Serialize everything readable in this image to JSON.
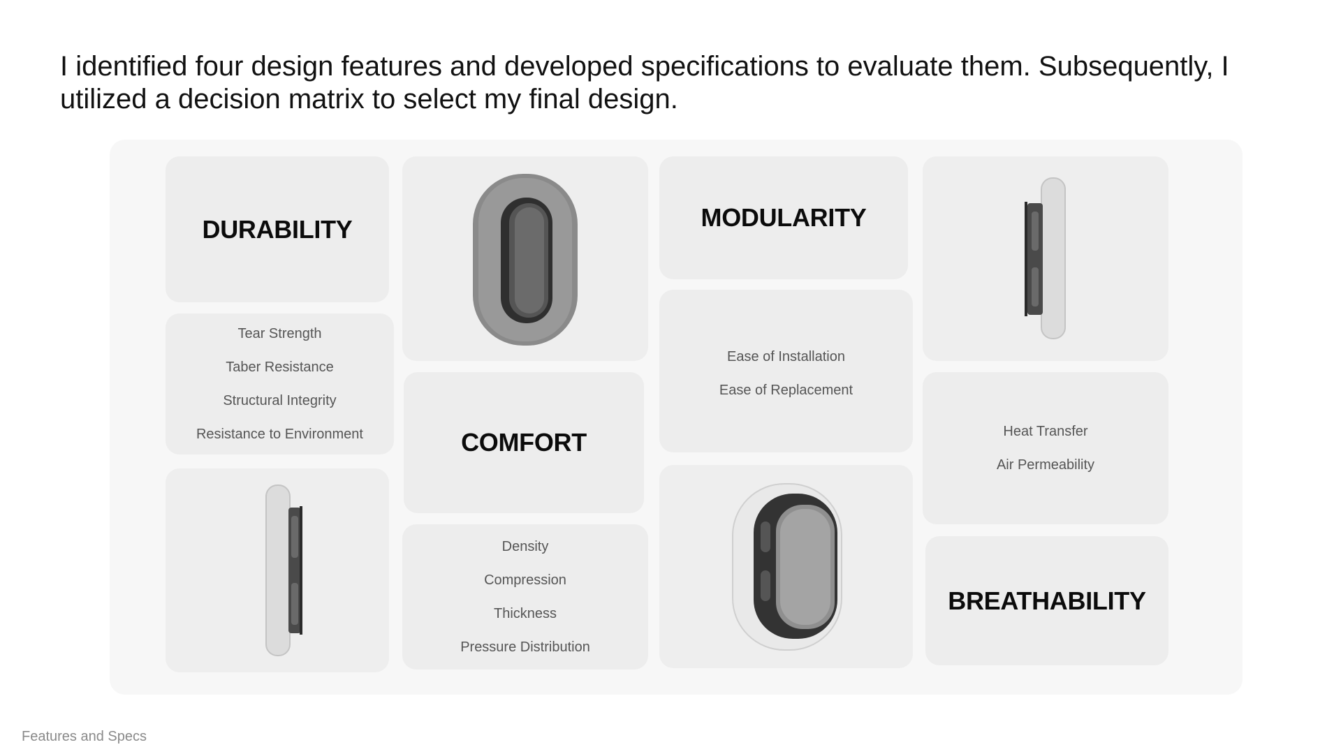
{
  "intro_text": "I identified four design features and developed specifications to evaluate them. Subsequently, I utilized a decision matrix to select my final design.",
  "features": {
    "durability": {
      "title": "DURABILITY",
      "specs": [
        "Tear Strength",
        "Taber Resistance",
        "Structural Integrity",
        "Resistance to Environment"
      ]
    },
    "comfort": {
      "title": "COMFORT",
      "specs": [
        "Density",
        "Compression",
        "Thickness",
        "Pressure Distribution"
      ]
    },
    "modularity": {
      "title": "MODULARITY",
      "specs": [
        "Ease of Installation",
        "Ease of Replacement"
      ]
    },
    "breathability": {
      "title": "BREATHABILITY",
      "specs": [
        "Heat Transfer",
        "Air Permeability"
      ]
    }
  },
  "images": {
    "front_gray": "ear-cushion-front-gray",
    "side_right": "ear-cushion-side-right",
    "side_left": "ear-cushion-side-left",
    "angled_white": "ear-cushion-angled-white"
  },
  "footer_label": "Features and Specs"
}
